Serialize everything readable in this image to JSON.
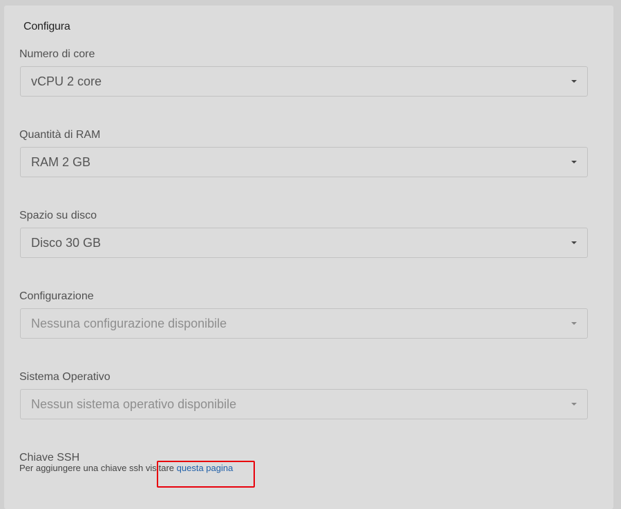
{
  "panel": {
    "title": "Configura"
  },
  "fields": [
    {
      "label": "Numero di core",
      "value": "vCPU 2 core",
      "disabled": false
    },
    {
      "label": "Quantità di RAM",
      "value": "RAM 2 GB",
      "disabled": false
    },
    {
      "label": "Spazio su disco",
      "value": "Disco 30 GB",
      "disabled": false
    },
    {
      "label": "Configurazione",
      "value": "Nessuna configurazione disponibile",
      "disabled": true
    },
    {
      "label": "Sistema Operativo",
      "value": "Nessun sistema operativo disponibile",
      "disabled": true
    }
  ],
  "ssh": {
    "label": "Chiave SSH",
    "help_text": "Per aggiungere una chiave ssh visitare ",
    "link_text": "questa pagina"
  },
  "colors": {
    "link": "#1f5fa8",
    "highlight": "#e8000b"
  }
}
